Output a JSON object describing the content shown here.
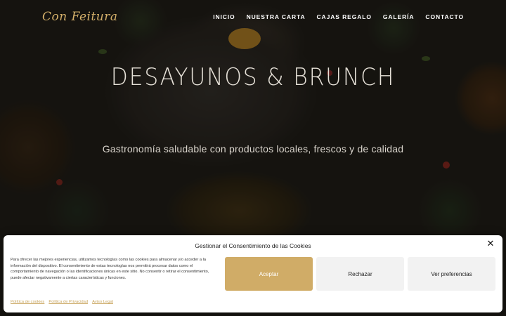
{
  "header": {
    "logo_text": "Con Feitura",
    "nav": [
      {
        "label": "INICIO"
      },
      {
        "label": "NUESTRA CARTA"
      },
      {
        "label": "CAJAS REGALO"
      },
      {
        "label": "GALERÍA"
      },
      {
        "label": "CONTACTO"
      }
    ]
  },
  "hero": {
    "title": "DESAYUNOS & BRUNCH",
    "subtitle": "Gastronomía saludable con productos locales, frescos y de calidad"
  },
  "cookie_banner": {
    "title": "Gestionar el Consentimiento de las Cookies",
    "close_icon": "close-icon",
    "body": "Para ofrecer las mejores experiencias, utilizamos tecnologías como las cookies para almacenar y/o acceder a la información del dispositivo. El consentimiento de estas tecnologías nos permitirá procesar datos como el comportamiento de navegación o las identificaciones únicas en este sitio. No consentir o retirar el consentimiento, puede afectar negativamente a ciertas características y funciones.",
    "buttons": {
      "accept": "Aceptar",
      "reject": "Rechazar",
      "preferences": "Ver preferencias"
    },
    "links": [
      {
        "label": "Política de cookies"
      },
      {
        "label": "Política de Privacidad"
      },
      {
        "label": "Aviso Legal"
      }
    ]
  },
  "colors": {
    "accent": "#d0ac67",
    "logo": "#d4b06a",
    "link": "#c9a55e"
  }
}
